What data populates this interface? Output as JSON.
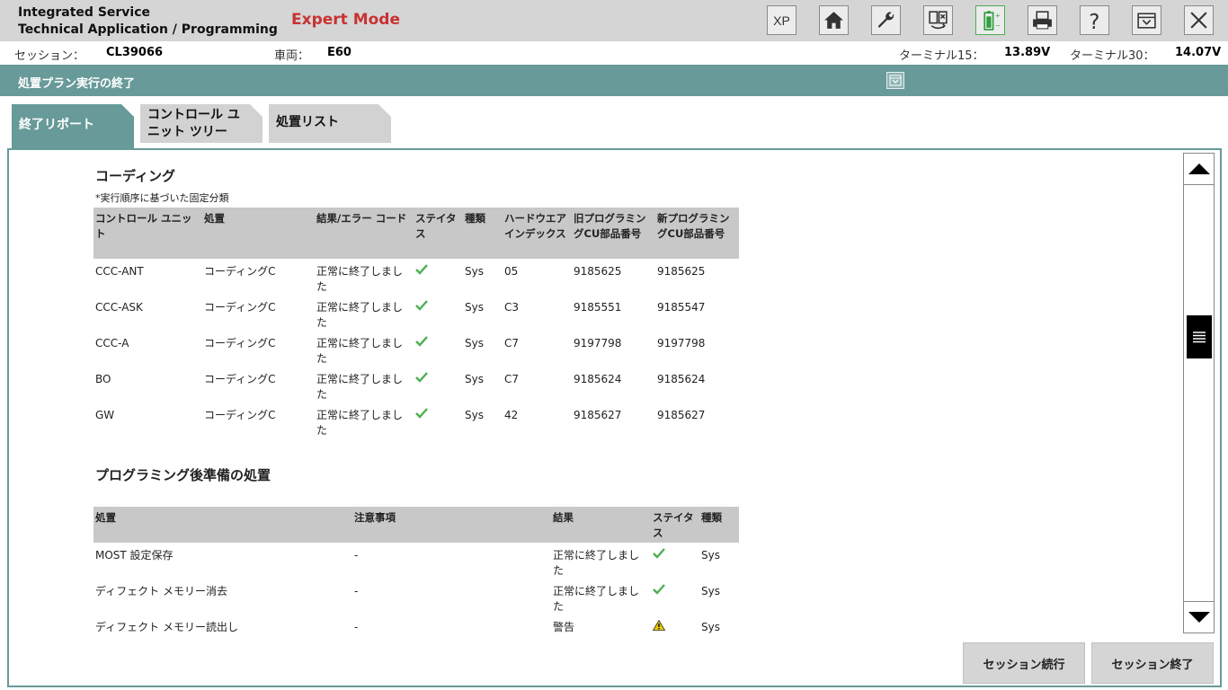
{
  "header": {
    "app_line1": "Integrated Service",
    "app_line2": "Technical Application / Programming",
    "mode": "Expert Mode",
    "toolbar": [
      {
        "name": "xp-button",
        "icon": "xp-text",
        "label": "XP"
      },
      {
        "name": "home-button",
        "icon": "home-icon"
      },
      {
        "name": "wrench-button",
        "icon": "wrench-icon"
      },
      {
        "name": "swap-button",
        "icon": "swap-icon"
      },
      {
        "name": "battery-button",
        "icon": "battery-icon"
      },
      {
        "name": "print-button",
        "icon": "printer-icon"
      },
      {
        "name": "help-button",
        "icon": "help-icon"
      },
      {
        "name": "menu-button",
        "icon": "dropdown-icon"
      },
      {
        "name": "close-button",
        "icon": "close-icon"
      }
    ]
  },
  "infobar": {
    "session_label": "セッション：",
    "session_value": "CL39066",
    "vehicle_label": "車両：",
    "vehicle_value": "E60",
    "t15_label": "ターミナル15：",
    "t15_value": "13.89V",
    "t30_label": "ターミナル30：",
    "t30_value": "14.07V"
  },
  "section": {
    "title": "処置プラン実行の終了"
  },
  "tabs": {
    "t1": "終了リポート",
    "t2_l1": "コントロール ユ",
    "t2_l2": "ニット ツリー",
    "t3": "処置リスト"
  },
  "coding": {
    "title": "コーディング",
    "note": "*実行順序に基づいた固定分類",
    "headers": [
      "コントロール ユニット",
      "処置",
      "結果/エラー コード",
      "ステイタス",
      "種類",
      "ハードウエア インデックス",
      "旧プログラミングCU部品番号",
      "新プログラミングCU部品番号"
    ],
    "rows": [
      [
        "CCC-ANT",
        "コーディングC",
        "正常に終了しました",
        "ok",
        "Sys",
        "05",
        "9185625",
        "9185625"
      ],
      [
        "CCC-ASK",
        "コーディングC",
        "正常に終了しました",
        "ok",
        "Sys",
        "C3",
        "9185551",
        "9185547"
      ],
      [
        "CCC-A",
        "コーディングC",
        "正常に終了しました",
        "ok",
        "Sys",
        "C7",
        "9197798",
        "9197798"
      ],
      [
        "BO",
        "コーディングC",
        "正常に終了しました",
        "ok",
        "Sys",
        "C7",
        "9185624",
        "9185624"
      ],
      [
        "GW",
        "コーディングC",
        "正常に終了しました",
        "ok",
        "Sys",
        "42",
        "9185627",
        "9185627"
      ]
    ]
  },
  "post": {
    "title": "プログラミング後準備の処置",
    "headers": [
      "処置",
      "注意事項",
      "結果",
      "ステイタス",
      "種類"
    ],
    "rows": [
      [
        "MOST 設定保存",
        "-",
        "正常に終了しました",
        "ok",
        "Sys"
      ],
      [
        "ディフェクト メモリー消去",
        "-",
        "正常に終了しました",
        "ok",
        "Sys"
      ],
      [
        "ディフェクト メモリー読出し",
        "-",
        "警告",
        "warn",
        "Sys"
      ]
    ]
  },
  "buttons": {
    "continue": "セッション続行",
    "end": "セッション終了"
  },
  "colors": {
    "accent": "#679a98",
    "mode": "#c83232",
    "ok": "#4caf50",
    "warn": "#e8c800"
  }
}
